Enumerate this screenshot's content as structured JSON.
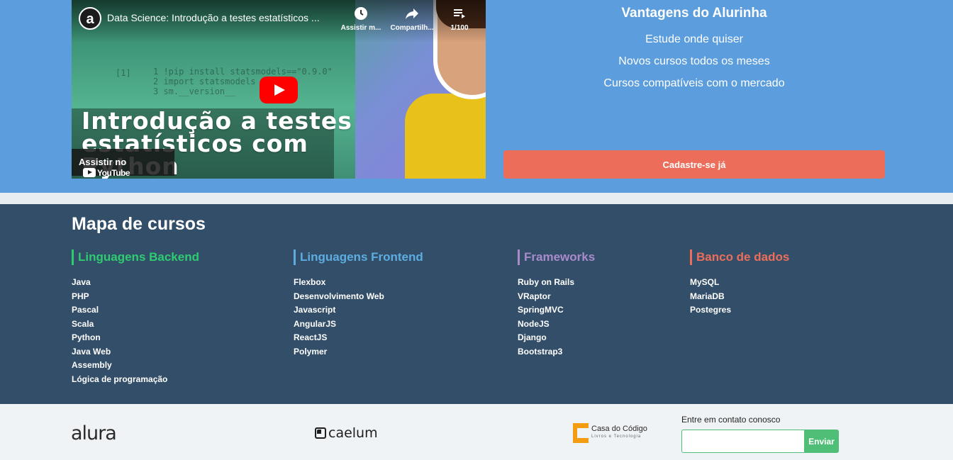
{
  "video": {
    "channel_logo_letter": "a",
    "title": "Data Science: Introdução a testes estatísticos ...",
    "watch_later_label": "Assistir m...",
    "share_label": "Compartilh...",
    "playlist_label": "1/100",
    "big_title_line1": "Introdução a testes",
    "big_title_line2": "estatísticos com",
    "big_title_line3": "Python",
    "watch_on_label": "Assistir no",
    "youtube_label": "YouTube",
    "code_cell_label": "[1]",
    "code_line1": "1 !pip install statsmodels==\"0.9.0\"",
    "code_line2": "2 import statsmodels",
    "code_line3": "3 sm.__version__"
  },
  "advantages": {
    "title": "Vantagens do Alurinha",
    "items": [
      "Estude onde quiser",
      "Novos cursos todos os meses",
      "Cursos compatíveis com o mercado"
    ],
    "signup_label": "Cadastre-se já",
    "signup_color": "#ec6e5a"
  },
  "course_map": {
    "title": "Mapa de cursos",
    "columns": [
      {
        "title": "Linguagens Backend",
        "color": "#2ecc71",
        "items": [
          "Java",
          "PHP",
          "Pascal",
          "Scala",
          "Python",
          "Java Web",
          "Assembly",
          "Lógica de programação"
        ]
      },
      {
        "title": "Linguagens Frontend",
        "color": "#5dade2",
        "items": [
          "Flexbox",
          "Desenvolvimento Web",
          "Javascript",
          "AngularJS",
          "ReactJS",
          "Polymer"
        ]
      },
      {
        "title": "Frameworks",
        "color": "#a98bcc",
        "items": [
          "Ruby on Rails",
          "VRaptor",
          "SpringMVC",
          "NodeJS",
          "Django",
          "Bootstrap3"
        ]
      },
      {
        "title": "Banco de dados",
        "color": "#ec6e5a",
        "items": [
          "MySQL",
          "MariaDB",
          "Postegres"
        ]
      }
    ]
  },
  "footer": {
    "alura_logo": "alura",
    "caelum_logo": "caelum",
    "cdc_logo_line1": "Casa do Código",
    "cdc_logo_line2": "Livros e Tecnologia",
    "contact_label": "Entre em contato conosco",
    "contact_input_value": "",
    "send_label": "Enviar",
    "send_color": "#4fbf77"
  }
}
